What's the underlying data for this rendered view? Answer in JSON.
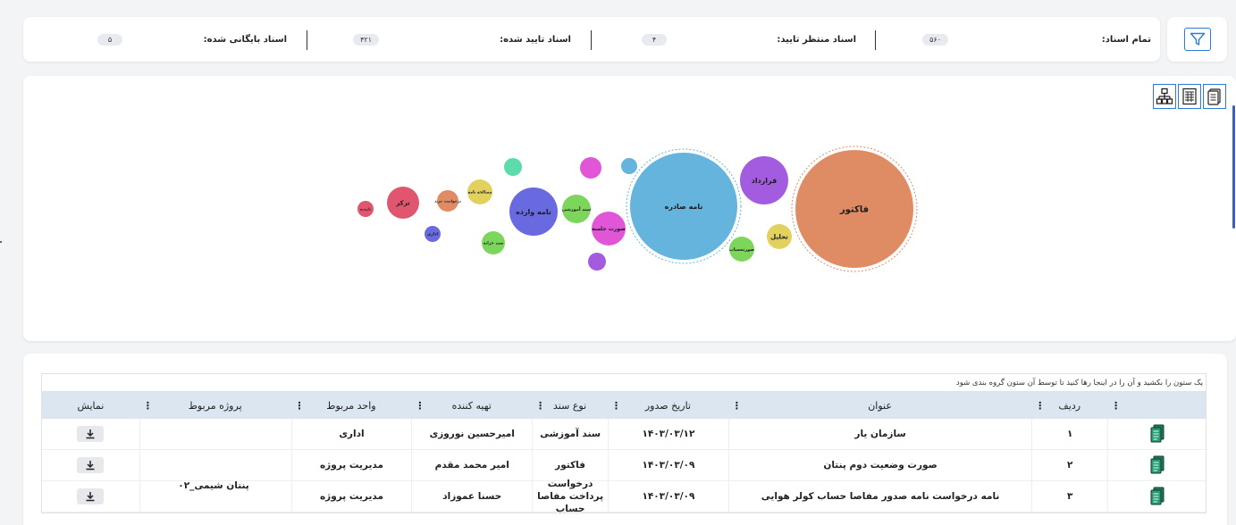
{
  "stats": {
    "total_label": "تمام اسناد:",
    "total_value": "۵۶۰",
    "pending_label": "اسناد منتظر تایید:",
    "pending_value": "۴",
    "approved_label": "اسناد تایید شده:",
    "approved_value": "۴۲۱",
    "archived_label": "اسناد بایگانی شده:",
    "archived_value": "۵"
  },
  "view_icons": [
    "document-list-icon",
    "document-table-icon",
    "hierarchy-icon"
  ],
  "bubbles": [
    {
      "label": "فاکتور",
      "color": "#df8c64"
    },
    {
      "label": "نامه صادره",
      "color": "#65b4dd"
    },
    {
      "label": "قرارداد",
      "color": "#a35ce0"
    },
    {
      "label": "تحلیل",
      "color": "#e2d15e"
    },
    {
      "label": "صورتحساب",
      "color": "#7dd65c"
    },
    {
      "label": "",
      "color": "#65b4dd"
    },
    {
      "label": "",
      "color": "#e056d6"
    },
    {
      "label": "صورت جلسه",
      "color": "#e056d6"
    },
    {
      "label": "سند آموزشی",
      "color": "#7dd65c"
    },
    {
      "label": "",
      "color": "#a35ce0"
    },
    {
      "label": "نامه وارده",
      "color": "#6a6ae0"
    },
    {
      "label": "",
      "color": "#5edbad"
    },
    {
      "label": "مصالحه نامه",
      "color": "#e2d15e"
    },
    {
      "label": "سند خزانه",
      "color": "#7dd65c"
    },
    {
      "label": "درخواست خرید",
      "color": "#df8c64"
    },
    {
      "label": "اداری",
      "color": "#6a6ae0"
    },
    {
      "label": "ترکر",
      "color": "#e0566e"
    },
    {
      "label": "تاییدیه",
      "color": "#e0566e"
    }
  ],
  "table": {
    "group_hint": "یک ستون را بکشید و آن را در اینجا رها کنید تا توسط آن ستون گروه بندی شود",
    "headers": {
      "idx": "ردیف",
      "title": "عنوان",
      "date": "تاریخ صدور",
      "type": "نوع سند",
      "preparer": "تهیه کننده",
      "unit": "واحد مربوط",
      "project": "پروژه مربوط",
      "view": "نمایش"
    },
    "project_merged": "پنتان شیمی_۰۲",
    "rows": [
      {
        "idx": "۱",
        "title": "سازمان یار",
        "date": "۱۴۰۳/۰۳/۱۲",
        "type": "سند آموزشی",
        "preparer": "امیرحسین نوروزی",
        "unit": "اداری"
      },
      {
        "idx": "۲",
        "title": "صورت وضعیت دوم پنتان",
        "date": "۱۴۰۳/۰۳/۰۹",
        "type": "فاکتور",
        "preparer": "امیر محمد مقدم",
        "unit": "مدیریت پروژه"
      },
      {
        "idx": "۳",
        "title": "نامه درخواست نامه صدور مفاصا حساب کولر هوایی",
        "date": "۱۴۰۳/۰۳/۰۹",
        "type": "درخواست پرداخت مفاصا حساب",
        "preparer": "حسنا عموزاد",
        "unit": "مدیریت پروژه"
      }
    ]
  }
}
